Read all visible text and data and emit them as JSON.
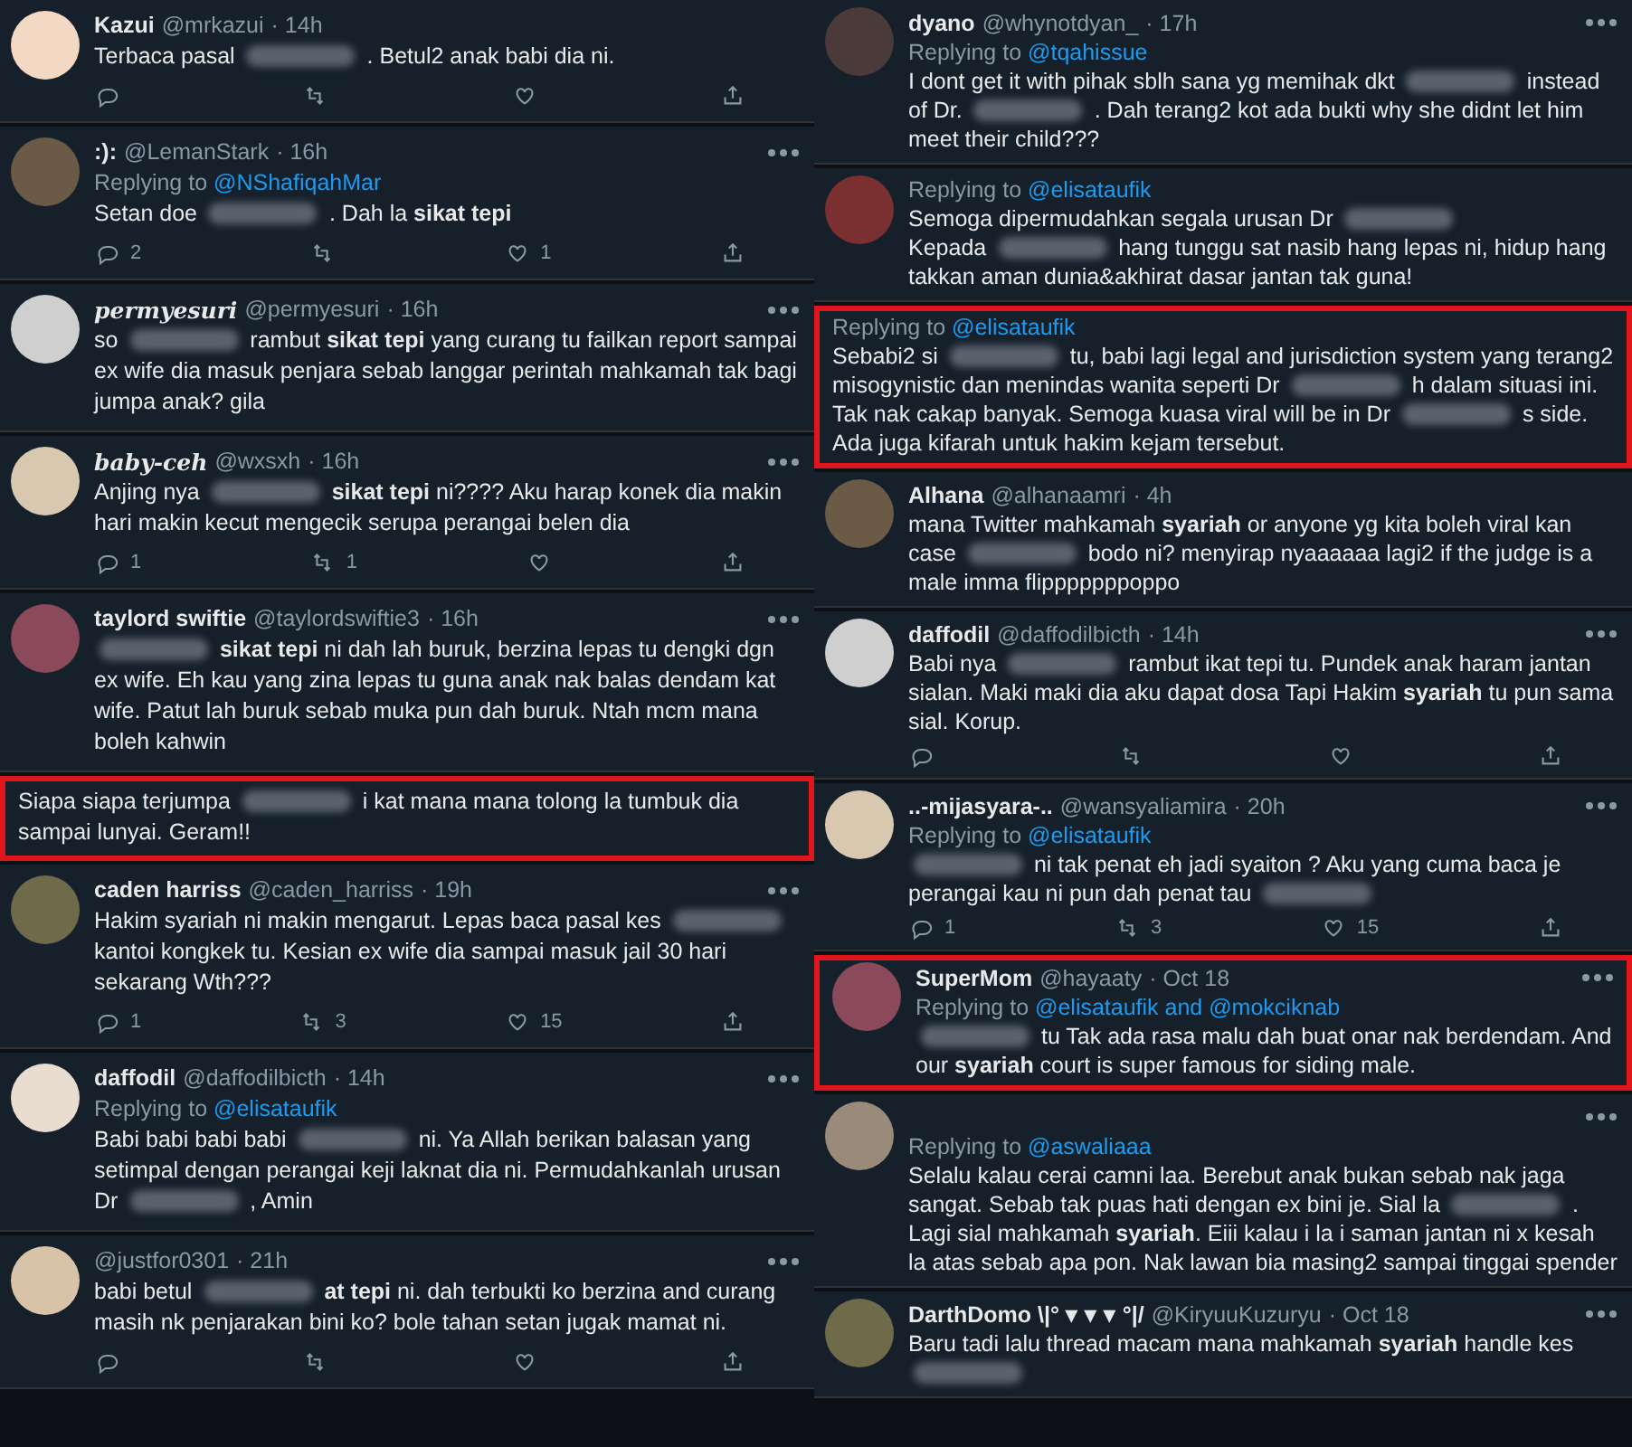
{
  "columns": [
    {
      "tweets": [
        {
          "name": "Kazui",
          "handle": "@mrkazui",
          "time": "· 14h",
          "avatar": true,
          "highlighted": false,
          "more": false,
          "parts": [
            {
              "kind": "text",
              "text": "Terbaca pasal"
            },
            {
              "kind": "blur"
            },
            {
              "kind": "text",
              "text": ". Betul2 anak babi dia ni."
            }
          ],
          "actions": [
            {
              "kind": "reply"
            },
            {
              "kind": "retweet"
            },
            {
              "kind": "like"
            },
            {
              "kind": "share"
            }
          ]
        },
        {
          "name": ":):",
          "handle": "@LemanStark",
          "time": "· 16h",
          "avatar": true,
          "highlighted": false,
          "more": true,
          "replying_label": "Replying to",
          "replying": "@NShafiqahMar",
          "parts": [
            {
              "kind": "text",
              "text": "Setan doe"
            },
            {
              "kind": "blur"
            },
            {
              "kind": "text",
              "text": ". Dah la **sikat tepi**"
            }
          ],
          "actions": [
            {
              "kind": "reply",
              "count": "2"
            },
            {
              "kind": "retweet"
            },
            {
              "kind": "like",
              "count": "1"
            },
            {
              "kind": "share"
            }
          ]
        },
        {
          "name": "permyesuri",
          "fancy": true,
          "handle": "@permyesuri",
          "time": "· 16h",
          "avatar": true,
          "highlighted": false,
          "more": true,
          "parts": [
            {
              "kind": "text",
              "text": "so"
            },
            {
              "kind": "blur"
            },
            {
              "kind": "text",
              "text": "rambut **sikat tepi** yang curang tu failkan report sampai ex wife dia masuk penjara sebab langgar perintah mahkamah tak bagi jumpa anak? gila"
            }
          ]
        },
        {
          "name": "baby-ceh",
          "fancy": true,
          "handle": "@wxsxh",
          "time": "· 16h",
          "avatar": true,
          "highlighted": false,
          "more": true,
          "parts": [
            {
              "kind": "text",
              "text": "Anjing nya"
            },
            {
              "kind": "blur"
            },
            {
              "kind": "text",
              "text": "**sikat tepi** ni???? Aku harap konek dia makin hari makin kecut mengecik serupa perangai belen dia"
            }
          ],
          "actions": [
            {
              "kind": "reply",
              "count": "1"
            },
            {
              "kind": "retweet",
              "count": "1"
            },
            {
              "kind": "like"
            },
            {
              "kind": "share"
            }
          ]
        },
        {
          "name": "taylord swiftie",
          "handle": "@taylordswiftie3",
          "time": "· 16h",
          "avatar": true,
          "highlighted": false,
          "more": true,
          "parts": [
            {
              "kind": "blur"
            },
            {
              "kind": "text",
              "text": "**sikat tepi** ni dah lah buruk, berzina lepas tu dengki dgn ex wife. Eh kau yang zina lepas tu guna anak nak balas dendam kat wife. Patut lah buruk sebab muka pun dah buruk. Ntah mcm mana boleh kahwin"
            }
          ]
        },
        {
          "highlighted": true,
          "more": false,
          "parts": [
            {
              "kind": "text",
              "text": "Siapa siapa terjumpa"
            },
            {
              "kind": "blur"
            },
            {
              "kind": "text",
              "text": "i kat mana mana tolong la tumbuk dia sampai lunyai. Geram!!"
            }
          ]
        },
        {
          "name": "caden harriss",
          "handle": "@caden_harriss",
          "time": "· 19h",
          "avatar": true,
          "highlighted": false,
          "more": true,
          "parts": [
            {
              "kind": "text",
              "text": "Hakim syariah ni makin mengarut. Lepas baca pasal kes"
            },
            {
              "kind": "blur"
            },
            {
              "kind": "text",
              "text": "kantoi kongkek tu. Kesian ex wife dia sampai masuk jail 30 hari sekarang Wth???"
            }
          ],
          "actions": [
            {
              "kind": "reply",
              "count": "1"
            },
            {
              "kind": "retweet",
              "count": "3"
            },
            {
              "kind": "like",
              "count": "15"
            },
            {
              "kind": "share"
            }
          ]
        },
        {
          "name": "daffodil",
          "handle": "@daffodilbicth",
          "time": "· 14h",
          "avatar": true,
          "highlighted": false,
          "more": true,
          "replying_label": "Replying to",
          "replying": "@elisataufik",
          "parts": [
            {
              "kind": "text",
              "text": "Babi babi babi babi"
            },
            {
              "kind": "blur"
            },
            {
              "kind": "text",
              "text": "ni. Ya Allah berikan balasan yang setimpal dengan perangai keji laknat dia ni. Permudahkanlah urusan Dr"
            },
            {
              "kind": "blur"
            },
            {
              "kind": "text",
              "text": ", Amin"
            }
          ]
        },
        {
          "handle": "@justfor0301",
          "time": "· 21h",
          "avatar": true,
          "highlighted": false,
          "more": true,
          "parts": [
            {
              "kind": "text",
              "text": "babi betul"
            },
            {
              "kind": "blur"
            },
            {
              "kind": "text",
              "text": "**at tepi** ni. dah terbukti ko berzina and curang masih nk penjarakan bini ko? bole tahan setan jugak mamat ni."
            }
          ],
          "actions": [
            {
              "kind": "reply"
            },
            {
              "kind": "retweet"
            },
            {
              "kind": "like"
            },
            {
              "kind": "share"
            }
          ]
        }
      ]
    },
    {
      "tweets": [
        {
          "name": "dyano",
          "handle": "@whynotdyan_",
          "time": "· 17h",
          "avatar": true,
          "highlighted": false,
          "more": true,
          "replying_label": "Replying to",
          "replying": "@tqahissue",
          "parts": [
            {
              "kind": "text",
              "text": "I dont get it with pihak sblh sana yg memihak dkt"
            },
            {
              "kind": "blur"
            },
            {
              "kind": "text",
              "text": "instead of Dr."
            },
            {
              "kind": "blur"
            },
            {
              "kind": "text",
              "text": ". Dah terang2 kot ada bukti why she didnt let him meet their child???"
            }
          ]
        },
        {
          "avatar": true,
          "highlighted": false,
          "more": false,
          "replying_label": "Replying to",
          "replying": "@elisataufik",
          "parts": [
            {
              "kind": "text",
              "text": "Semoga dipermudahkan segala urusan Dr"
            },
            {
              "kind": "blur"
            },
            {
              "kind": "break"
            },
            {
              "kind": "text",
              "text": "Kepada"
            },
            {
              "kind": "blur"
            },
            {
              "kind": "text",
              "text": "hang tunggu sat nasib hang lepas ni, hidup hang takkan aman dunia&akhirat dasar jantan tak guna!"
            }
          ]
        },
        {
          "highlighted": true,
          "more": false,
          "replying_label": "Replying to",
          "replying": "@elisataufik",
          "parts": [
            {
              "kind": "text",
              "text": "Sebabi2 si"
            },
            {
              "kind": "blur"
            },
            {
              "kind": "text",
              "text": "tu, babi lagi legal and jurisdiction system yang terang2 misogynistic dan menindas wanita seperti Dr"
            },
            {
              "kind": "blur"
            },
            {
              "kind": "text",
              "text": "h dalam situasi ini. Tak nak cakap banyak. Semoga kuasa viral will be in Dr"
            },
            {
              "kind": "blur"
            },
            {
              "kind": "text",
              "text": "s side. Ada juga kifarah untuk hakim kejam tersebut."
            }
          ]
        },
        {
          "name": "Alhana",
          "handle": "@alhanaamri",
          "time": "· 4h",
          "avatar": true,
          "highlighted": false,
          "more": false,
          "parts": [
            {
              "kind": "text",
              "text": "mana Twitter mahkamah **syariah** or anyone yg kita boleh viral kan case"
            },
            {
              "kind": "blur"
            },
            {
              "kind": "text",
              "text": "bodo ni? menyirap nyaaaaaa lagi2 if the judge is a male imma flipppppppoppo"
            }
          ]
        },
        {
          "name": "daffodil",
          "handle": "@daffodilbicth",
          "time": "· 14h",
          "avatar": true,
          "highlighted": false,
          "more": true,
          "parts": [
            {
              "kind": "text",
              "text": "Babi nya"
            },
            {
              "kind": "blur"
            },
            {
              "kind": "text",
              "text": "rambut ikat tepi tu. Pundek anak haram jantan sialan. Maki maki dia aku dapat dosa Tapi Hakim **syariah** tu pun sama sial. Korup."
            }
          ],
          "actions": [
            {
              "kind": "reply"
            },
            {
              "kind": "retweet"
            },
            {
              "kind": "like"
            },
            {
              "kind": "share"
            }
          ]
        },
        {
          "name": "..-mijasyara-..",
          "handle": "@wansyaliamira",
          "time": "· 20h",
          "avatar": true,
          "highlighted": false,
          "more": true,
          "replying_label": "Replying to",
          "replying": "@elisataufik",
          "parts": [
            {
              "kind": "blur"
            },
            {
              "kind": "text",
              "text": "ni tak penat eh jadi syaiton ? Aku yang cuma baca je perangai kau ni pun dah penat tau"
            },
            {
              "kind": "blur"
            }
          ],
          "actions": [
            {
              "kind": "reply",
              "count": "1"
            },
            {
              "kind": "retweet",
              "count": "3"
            },
            {
              "kind": "like",
              "count": "15"
            },
            {
              "kind": "share"
            }
          ]
        },
        {
          "name": "SuperMom",
          "handle": "@hayaaty",
          "time": "· Oct 18",
          "avatar": true,
          "highlighted": true,
          "more": true,
          "replying_label": "Replying to",
          "replying": "@elisataufik and @mokciknab",
          "parts": [
            {
              "kind": "blur"
            },
            {
              "kind": "text",
              "text": "tu Tak ada rasa malu dah buat onar nak berdendam. And our **syariah** court is super famous for siding male."
            }
          ]
        },
        {
          "avatar": true,
          "highlighted": false,
          "more": true,
          "replying_label": "Replying to",
          "replying": "@aswaliaaa",
          "parts": [
            {
              "kind": "text",
              "text": "Selalu kalau cerai camni laa. Berebut anak bukan sebab nak jaga sangat. Sebab tak puas hati dengan ex bini je. Sial la"
            },
            {
              "kind": "blur"
            },
            {
              "kind": "text",
              "text": ". Lagi sial mahkamah **syariah**. Eiii kalau i la i saman jantan ni x kesah la atas sebab apa pon. Nak lawan bia masing2 sampai tinggai spender"
            }
          ]
        },
        {
          "name": "DarthDomo \\|° ▾ ▾ ▾ °|/",
          "handle": "@KiryuuKuzuryu",
          "time": "· Oct 18",
          "avatar": true,
          "highlighted": false,
          "more": true,
          "parts": [
            {
              "kind": "text",
              "text": "Baru tadi lalu thread macam mana mahkamah **syariah** handle kes"
            },
            {
              "kind": "blur"
            }
          ]
        }
      ]
    }
  ]
}
